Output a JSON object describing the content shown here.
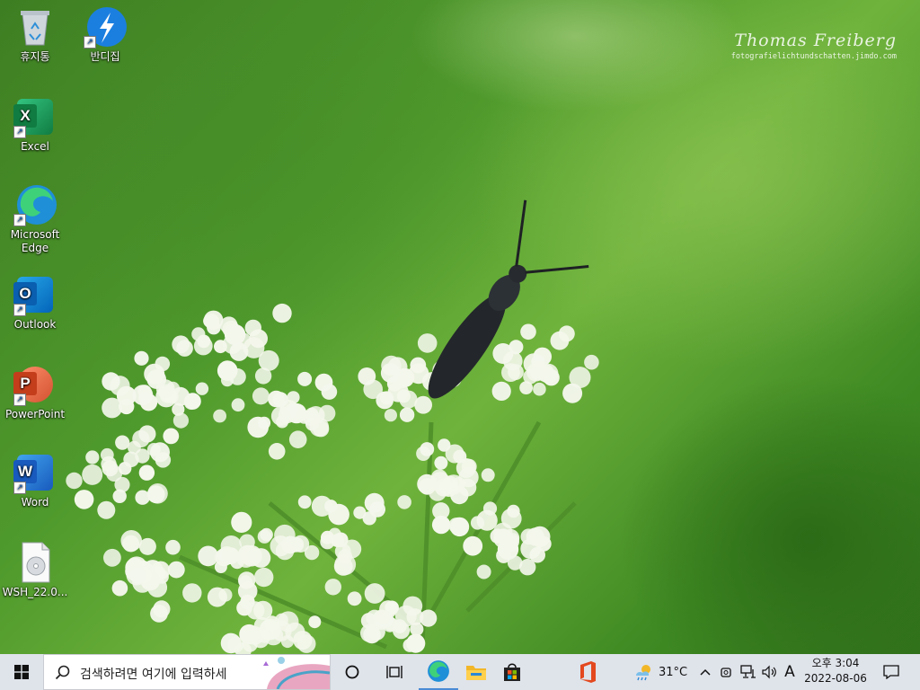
{
  "desktop": {
    "icons": [
      {
        "label": "휴지통",
        "icon": "recycle-bin-icon"
      },
      {
        "label": "반디집",
        "icon": "bandizip-icon"
      },
      {
        "label": "Excel",
        "icon": "excel-icon"
      },
      {
        "label": "Microsoft\nEdge",
        "icon": "edge-icon"
      },
      {
        "label": "Outlook",
        "icon": "outlook-icon"
      },
      {
        "label": "PowerPoint",
        "icon": "powerpoint-icon"
      },
      {
        "label": "Word",
        "icon": "word-icon"
      },
      {
        "label": "WSH_22.0...",
        "icon": "disc-image-file-icon"
      }
    ]
  },
  "wallpaper": {
    "watermark_name": "Thomas Freiberg",
    "watermark_url": "fotografielichtundschatten.jimdo.com"
  },
  "taskbar": {
    "search_placeholder": "검색하려면 여기에 입력하세",
    "weather_temp": "31°C",
    "ime": "A",
    "time": "오후 3:04",
    "date": "2022-08-06",
    "colors": {
      "edge": "#0f7fd4",
      "explorer": "#f2b728",
      "office": "#e3481f",
      "store": "#e3481f"
    }
  }
}
